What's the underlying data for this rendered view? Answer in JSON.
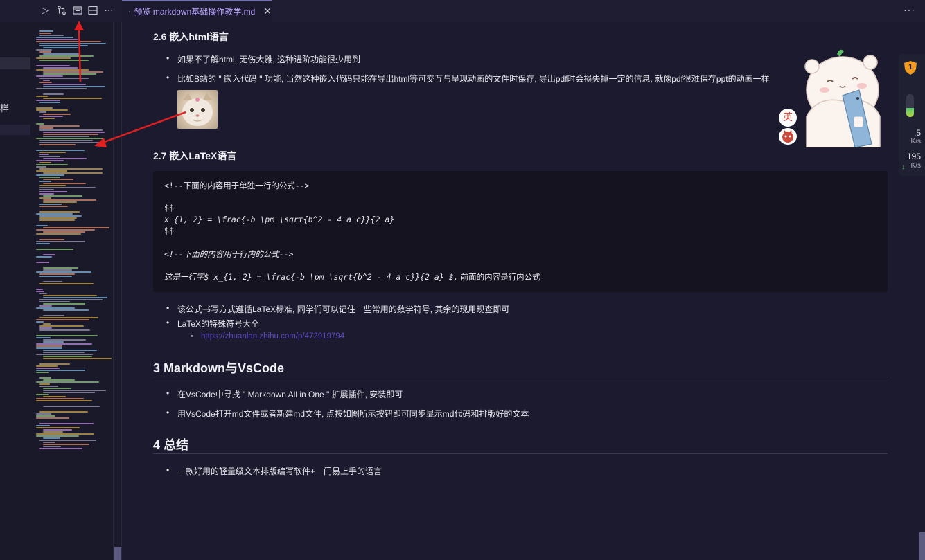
{
  "tab": {
    "label": "预览 markdown基础操作教学.md",
    "close": "✕",
    "more": "···"
  },
  "toolbar": {
    "run": "▷",
    "more": "···"
  },
  "gutter": {
    "char": "样"
  },
  "content": {
    "h_2_6": "2.6 嵌入html语言",
    "b_2_6_1": "如果不了解html, 无伤大雅, 这种进阶功能很少用到",
    "b_2_6_2": "比如B站的 \" 嵌入代码 \" 功能, 当然这种嵌入代码只能在导出html等可交互与呈现动画的文件时保存, 导出pdf时会损失掉一定的信息, 就像pdf很难保存ppt的动画一样",
    "h_2_7": "2.7 嵌入LaTeX语言",
    "code": {
      "l1": "<!--下面的内容用于单独一行的公式-->",
      "l2": "$$",
      "l3": "x_{1, 2} = \\frac{-b \\pm \\sqrt{b^2 - 4 a c}}{2 a}",
      "l4": "$$",
      "l5": "<!--下面的内容用于行内的公式-->",
      "l6a": "这是一行字$ x_{1, 2} = \\frac{-b \\pm \\sqrt{b^2 - 4 a c}}{2 a} $,",
      "l6b": " 前面的内容是行内公式"
    },
    "b_2_7_1": "该公式书写方式遵循LaTeX标准, 同学们可以记住一些常用的数学符号, 其余的现用现查即可",
    "b_2_7_2": "LaTeX的特殊符号大全",
    "link": "https://zhuanlan.zhihu.com/p/472919794",
    "h_3": "3 Markdown与VsCode",
    "b_3_1": "在VsCode中寻找 \" Markdown All in One \" 扩展插件, 安装即可",
    "b_3_2": "用VsCode打开md文件或者新建md文件, 点按如图所示按钮即可同步显示md代码和排版好的文本",
    "h_4": "4 总结",
    "b_4_1": "一款好用的轻量级文本排版编写软件+一门易上手的语言"
  },
  "widgets": {
    "ime_label": "英",
    "shield_count": "1",
    "memory_level": 0.4,
    "upload_speed": ".5",
    "upload_unit": "K/s",
    "download_speed": "195",
    "download_unit": "K/s",
    "down_arrow": "↓"
  },
  "colors": {
    "background": "#1b1a2e",
    "accent_tab": "#6e6cc7",
    "link": "#5b4bc3",
    "arrow": "#e02020"
  }
}
